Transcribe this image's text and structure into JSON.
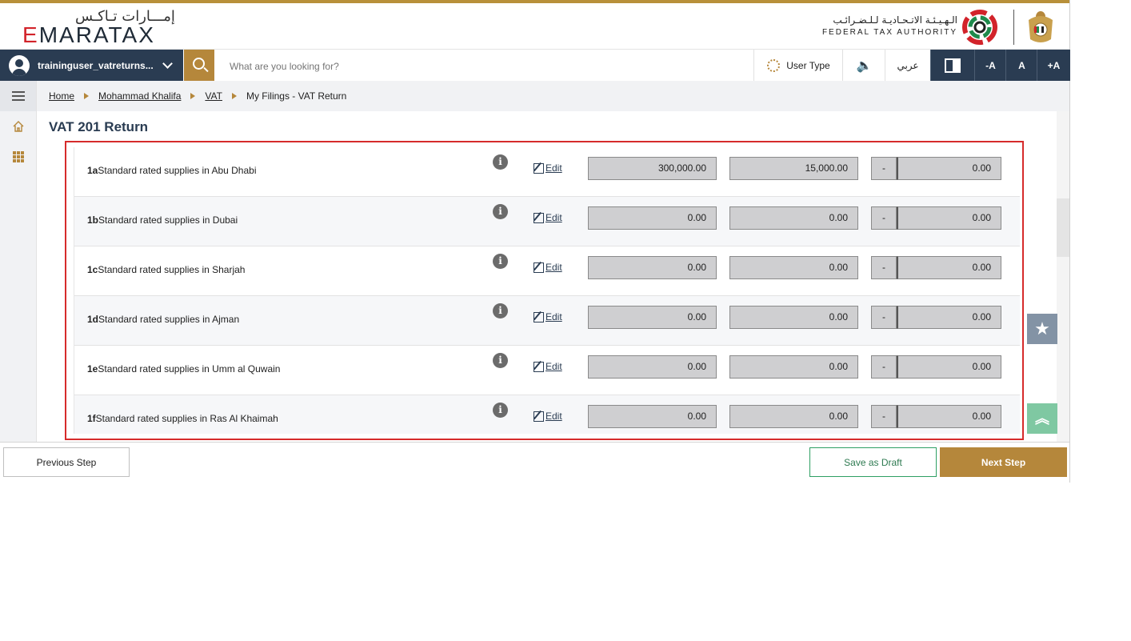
{
  "branding": {
    "logo_ar": "إمـــارات تـاكـس",
    "logo_en_first": "E",
    "logo_en_rest": "MARATAX",
    "authority_ar": "الـهـيـئـة الاتـحـاديـة لـلـضـرائـب",
    "authority_en": "FEDERAL TAX AUTHORITY"
  },
  "toolbar": {
    "user_name": "traininguser_vatreturns...",
    "search_placeholder": "What are you looking for?",
    "user_type_label": "User Type",
    "speaker_glyph": "🔈",
    "arabic_label": "عربي",
    "font_decrease": "-A",
    "font_normal": "A",
    "font_increase": "+A"
  },
  "breadcrumb": {
    "items": [
      "Home",
      "Mohammad Khalifa",
      "VAT"
    ],
    "current": "My Filings - VAT Return"
  },
  "page": {
    "title": "VAT 201 Return"
  },
  "rows": [
    {
      "code": "1a",
      "label": "Standard rated supplies in Abu Dhabi",
      "edit": "Edit",
      "amount": "300,000.00",
      "vat": "15,000.00",
      "adj_sign": "-",
      "adj": "0.00"
    },
    {
      "code": "1b",
      "label": "Standard rated supplies in Dubai",
      "edit": "Edit",
      "amount": "0.00",
      "vat": "0.00",
      "adj_sign": "-",
      "adj": "0.00"
    },
    {
      "code": "1c",
      "label": "Standard rated supplies in Sharjah",
      "edit": "Edit",
      "amount": "0.00",
      "vat": "0.00",
      "adj_sign": "-",
      "adj": "0.00"
    },
    {
      "code": "1d",
      "label": "Standard rated supplies in Ajman",
      "edit": "Edit",
      "amount": "0.00",
      "vat": "0.00",
      "adj_sign": "-",
      "adj": "0.00"
    },
    {
      "code": "1e",
      "label": "Standard rated supplies in Umm al Quwain",
      "edit": "Edit",
      "amount": "0.00",
      "vat": "0.00",
      "adj_sign": "-",
      "adj": "0.00"
    },
    {
      "code": "1f",
      "label": "Standard rated supplies in Ras Al Khaimah",
      "edit": "Edit",
      "amount": "0.00",
      "vat": "0.00",
      "adj_sign": "-",
      "adj": "0.00"
    }
  ],
  "footer": {
    "previous": "Previous Step",
    "save_draft": "Save as Draft",
    "next": "Next Step"
  },
  "icons": {
    "info": "i",
    "star": "★",
    "scroll_top": "︽"
  },
  "colors": {
    "brand_gold": "#b5873b",
    "navy": "#2a3c52",
    "highlight_red": "#d62b2b",
    "draft_green": "#2e9f63"
  }
}
